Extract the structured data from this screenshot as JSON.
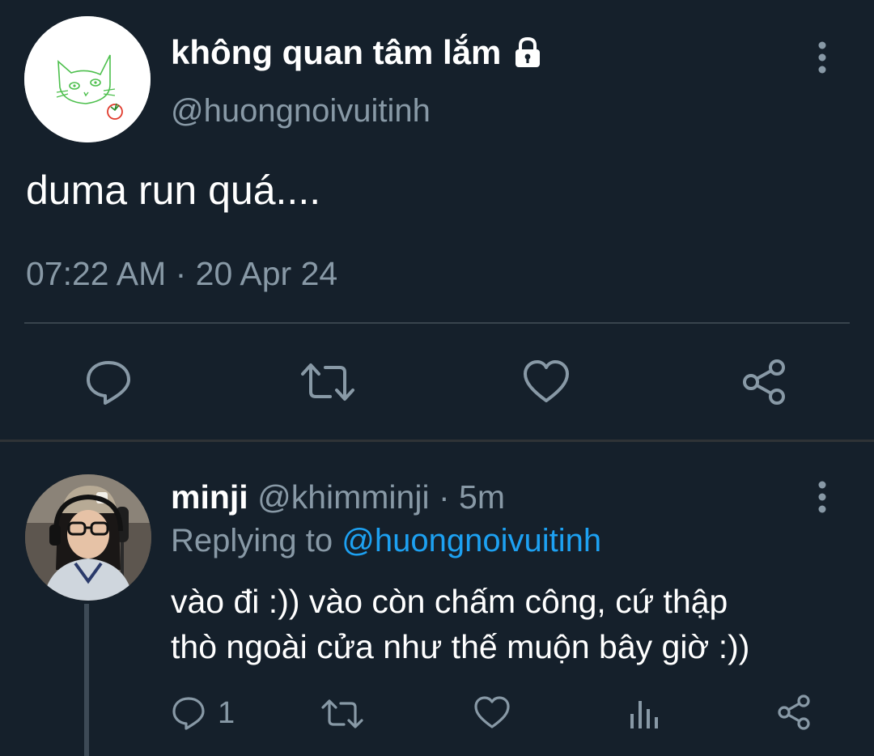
{
  "main_tweet": {
    "author_name": "không quan tâm lắm",
    "author_handle": "@huongnoivuitinh",
    "text": "duma run quá....",
    "timestamp": "07:22 AM · 20 Apr 24",
    "avatar_icon": "cat-doodle-avatar",
    "lock_icon": "lock-icon",
    "actions": [
      "reply-icon",
      "retweet-icon",
      "like-icon",
      "share-icon"
    ]
  },
  "reply_tweet": {
    "author_name": "minji",
    "author_handle": "@khimminji",
    "separator": "·",
    "time": "5m",
    "replying_prefix": "Replying to",
    "replying_handle": "@huongnoivuitinh",
    "text_line1": "vào đi :)) vào còn chấm công, cứ thập",
    "text_line2": "thò ngoài cửa như thế muộn bây giờ :))",
    "reply_count": "1",
    "actions": [
      "reply-icon",
      "retweet-icon",
      "like-icon",
      "stats-icon",
      "share-icon"
    ]
  },
  "colors": {
    "background": "#15202b",
    "text_primary": "#ffffff",
    "text_secondary": "#8899a6",
    "link": "#1da1f2",
    "divider": "#38444d"
  }
}
